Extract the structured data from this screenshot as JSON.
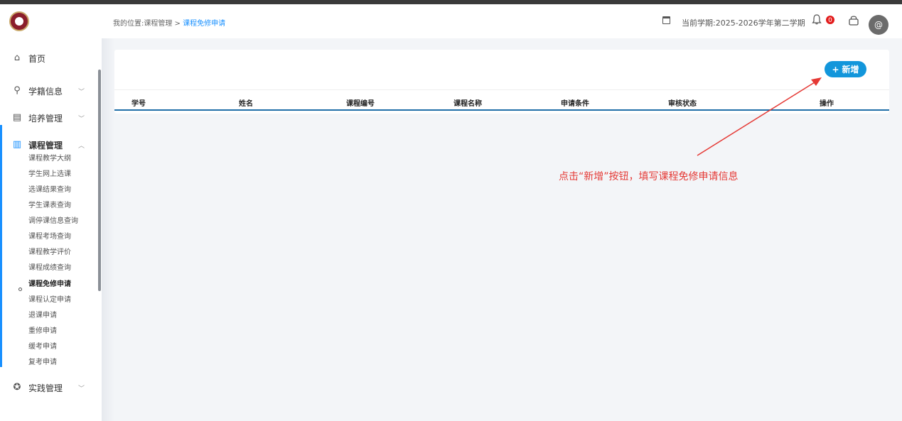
{
  "breadcrumb": {
    "prefix": "我的位置:课程管理 > ",
    "current": "课程免修申请"
  },
  "header": {
    "semester": "当前学期:2025-2026学年第二学期",
    "badge_count": "0",
    "avatar_glyph": "@"
  },
  "menu": [
    {
      "label": "首页",
      "icon": "home-icon",
      "glyph": "⌂"
    },
    {
      "label": "学籍信息",
      "icon": "user-icon",
      "glyph": "⚲",
      "caret": "﹀"
    },
    {
      "label": "培养管理",
      "icon": "document-icon",
      "glyph": "▤",
      "caret": "﹀"
    },
    {
      "label": "课程管理",
      "icon": "chart-icon",
      "glyph": "▥",
      "caret": "︿"
    },
    {
      "label": "实践管理",
      "icon": "star-icon",
      "glyph": "✪",
      "caret": "﹀"
    }
  ],
  "submenu": [
    "课程教学大纲",
    "学生网上选课",
    "选课结果查询",
    "学生课表查询",
    "调停课信息查询",
    "课程考场查询",
    "课程教学评价",
    "课程成绩查询",
    "课程免修申请",
    "课程认定申请",
    "退课申请",
    "重修申请",
    "缓考申请",
    "复考申请"
  ],
  "add_button": {
    "plus": "+",
    "label": "新增"
  },
  "table": {
    "headers": [
      "学号",
      "姓名",
      "课程编号",
      "课程名称",
      "申请条件",
      "审核状态",
      "操作"
    ]
  },
  "annotation": "点击“新增”按钮，填写课程免修申请信息",
  "colors": {
    "accent": "#1890ff",
    "button": "#1296db",
    "annotation": "#e53935"
  }
}
